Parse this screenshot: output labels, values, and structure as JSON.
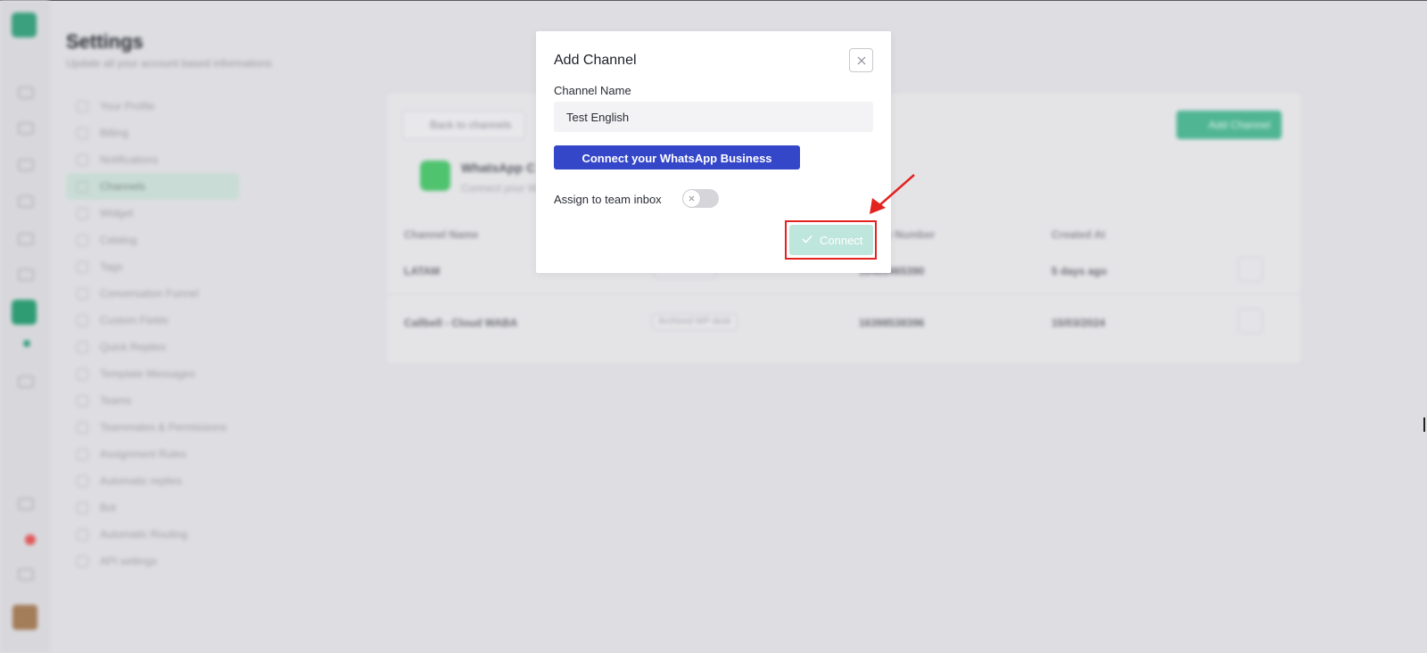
{
  "background": {
    "settings_title": "Settings",
    "settings_subtitle": "Update all your account based informations",
    "menu": [
      {
        "label": "Your Profile",
        "active": false
      },
      {
        "label": "Billing",
        "active": false
      },
      {
        "label": "Notifications",
        "active": false
      },
      {
        "label": "Channels",
        "active": true
      },
      {
        "label": "Widget",
        "active": false
      },
      {
        "label": "Catalog",
        "active": false
      },
      {
        "label": "Tags",
        "active": false
      },
      {
        "label": "Conversation Funnel",
        "active": false
      },
      {
        "label": "Custom Fields",
        "active": false
      },
      {
        "label": "Quick Replies",
        "active": false
      },
      {
        "label": "Template Messages",
        "active": false
      },
      {
        "label": "Teams",
        "active": false
      },
      {
        "label": "Teammates & Permissions",
        "active": false
      },
      {
        "label": "Assignment Rules",
        "active": false
      },
      {
        "label": "Automatic replies",
        "active": false
      },
      {
        "label": "Bot",
        "active": false
      },
      {
        "label": "Automatic Routing",
        "active": false
      },
      {
        "label": "API settings",
        "active": false
      }
    ],
    "back_button": "Back to channels",
    "add_channel_button": "Add Channel",
    "channel_type_title": "WhatsApp C",
    "channel_type_sub": "Connect your W",
    "table_headers": [
      "Channel Name",
      "",
      "Phone Number",
      "Created At"
    ],
    "rows": [
      {
        "name": "LATAM",
        "status": "",
        "phone": "16466465390",
        "created": "5 days ago"
      },
      {
        "name": "Callbell - Cloud WABA",
        "status": "Archived WP desk",
        "phone": "16398538396",
        "created": "15/03/2024"
      }
    ]
  },
  "modal": {
    "title": "Add Channel",
    "close_icon": "close-icon",
    "channel_name_label": "Channel Name",
    "channel_name_value": "Test English",
    "connect_whatsapp_button": "Connect your WhatsApp Business Account",
    "assign_label": "Assign to team inbox",
    "assign_toggle_on": false,
    "connect_button": "Connect",
    "connect_icon": "check-icon"
  },
  "colors": {
    "primary_blue": "#3547c9",
    "connect_disabled": "#bfe6dc",
    "highlight_red": "#e3231f",
    "brand_green": "#3aa07d"
  }
}
